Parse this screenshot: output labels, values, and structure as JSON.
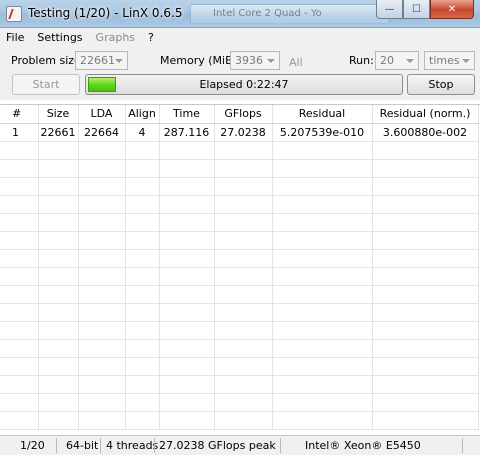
{
  "window": {
    "title": "Testing (1/20) - LinX 0.6.5",
    "background_tab_title": "Intel Core 2 Quad - Yo",
    "buttons": {
      "minimize": "—",
      "maximize": "☐",
      "close": "✕"
    }
  },
  "menu": [
    "File",
    "Settings",
    "Graphs",
    "?"
  ],
  "toolbar": {
    "problem_size_label": "Problem size:",
    "problem_size_value": "22661",
    "memory_label": "Memory (MiB):",
    "memory_value": "3936",
    "all_label": "All",
    "run_label": "Run:",
    "run_value": "20",
    "times_value": "times",
    "start_label": "Start",
    "stop_label": "Stop",
    "elapsed_text": "Elapsed 0:22:47",
    "progress_fraction": 0.1,
    "progress_color": "#5fd61c"
  },
  "table": {
    "columns": [
      "#",
      "Size",
      "LDA",
      "Align",
      "Time",
      "GFlops",
      "Residual",
      "Residual (norm.)"
    ],
    "rows": [
      [
        "1",
        "22661",
        "22664",
        "4",
        "287.116",
        "27.0238",
        "5.207539e-010",
        "3.600880e-002"
      ]
    ]
  },
  "status": {
    "progress": "1/20",
    "arch": "64-bit",
    "threads": "4 threads",
    "peak": "27.0238 GFlops peak",
    "cpu": "Intel® Xeon® E5450"
  }
}
